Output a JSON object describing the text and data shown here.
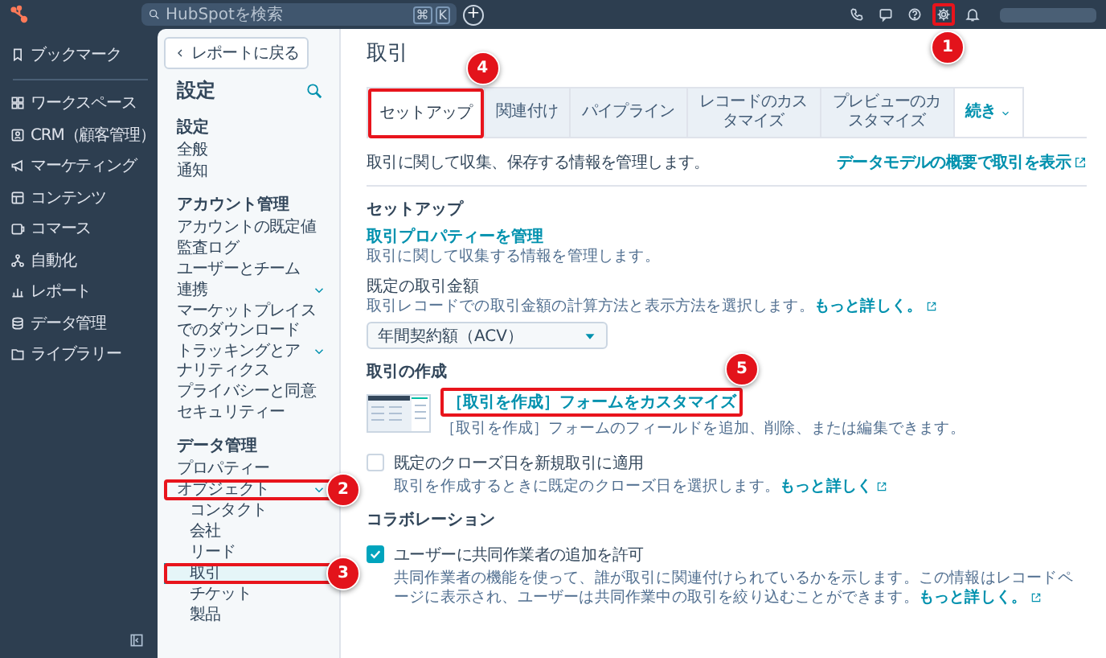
{
  "topbar": {
    "search": {
      "placeholder": "HubSpotを検索",
      "shortcut": [
        "⌘",
        "K"
      ]
    },
    "add_button": "+",
    "icons": [
      {
        "kind": "phone"
      },
      {
        "kind": "chat"
      },
      {
        "kind": "help"
      },
      {
        "kind": "settings",
        "callout": "1"
      },
      {
        "kind": "bell"
      }
    ]
  },
  "nav": {
    "items": [
      {
        "kind": "bookmark",
        "label": "ブックマーク"
      },
      {
        "kind": "workspace",
        "label": "ワークスペース"
      },
      {
        "kind": "crm",
        "label": "CRM（顧客管理）"
      },
      {
        "kind": "marketing",
        "label": "マーケティング"
      },
      {
        "kind": "content",
        "label": "コンテンツ"
      },
      {
        "kind": "commerce",
        "label": "コマース"
      },
      {
        "kind": "automation",
        "label": "自動化"
      },
      {
        "kind": "report",
        "label": "レポート"
      },
      {
        "kind": "data",
        "label": "データ管理"
      },
      {
        "kind": "library",
        "label": "ライブラリー"
      }
    ]
  },
  "settings_nav": {
    "back": "レポートに戻る",
    "title": "設定",
    "sections": [
      {
        "heading": "設定",
        "items": [
          {
            "label": "全般",
            "expandable": false,
            "selected": false
          },
          {
            "label": "通知",
            "expandable": false,
            "selected": false
          }
        ]
      },
      {
        "heading": "アカウント管理",
        "items": [
          {
            "label": "アカウントの既定値",
            "expandable": false,
            "selected": false
          },
          {
            "label": "監査ログ",
            "expandable": false,
            "selected": false
          },
          {
            "label": "ユーザーとチーム",
            "expandable": false,
            "selected": false
          },
          {
            "label": "連携",
            "expandable": true,
            "selected": false
          },
          {
            "label": "マーケットプレイスでのダウンロード",
            "expandable": false,
            "selected": false
          },
          {
            "label": "トラッキングとアナリティクス",
            "expandable": true,
            "selected": false
          },
          {
            "label": "プライバシーと同意",
            "expandable": false,
            "selected": false
          },
          {
            "label": "セキュリティー",
            "expandable": false,
            "selected": false
          }
        ]
      },
      {
        "heading": "データ管理",
        "items": [
          {
            "label": "プロパティー",
            "expandable": false,
            "selected": false
          },
          {
            "label": "オブジェクト",
            "expandable": true,
            "selected": false,
            "callout": "2",
            "children": [
              {
                "label": "コンタクト",
                "expandable": false,
                "selected": false
              },
              {
                "label": "会社",
                "expandable": false,
                "selected": false
              },
              {
                "label": "リード",
                "expandable": false,
                "selected": false
              },
              {
                "label": "取引",
                "expandable": false,
                "selected": true,
                "callout": "3"
              },
              {
                "label": "チケット",
                "expandable": false,
                "selected": false
              },
              {
                "label": "製品",
                "expandable": false,
                "selected": false
              }
            ]
          }
        ]
      }
    ]
  },
  "page": {
    "title": "取引",
    "view_link": "データモデルの概要で取引を表示",
    "tabs": [
      {
        "label": "セットアップ",
        "kind": "tab",
        "selected": true,
        "callout": "4"
      },
      {
        "label": "関連付け",
        "kind": "tab",
        "selected": false
      },
      {
        "label": "パイプライン",
        "kind": "tab",
        "selected": false
      },
      {
        "label": "レコードのカスタマイズ",
        "kind": "tab",
        "selected": false
      },
      {
        "label": "プレビューのカスタマイズ",
        "kind": "tab",
        "selected": false
      },
      {
        "label": "続き",
        "kind": "more",
        "selected": false
      }
    ],
    "description": "取引に関して収集、保存する情報を管理します。",
    "sections": [
      {
        "heading": "セットアップ",
        "items": [
          {
            "kind": "link",
            "link": "取引プロパティーを管理",
            "description": {
              "text": "取引に関して収集する情報を管理します。"
            }
          },
          {
            "kind": "select",
            "label": "既定の取引金額",
            "description": {
              "text": "取引レコードでの取引金額の計算方法と表示方法を選択します。",
              "link": "もっと詳しく。"
            },
            "value": "年間契約額（ACV）"
          }
        ]
      },
      {
        "heading": "取引の作成",
        "items": [
          {
            "kind": "preview_link",
            "link": "［取引を作成］フォームをカスタマイズ",
            "callout": "5",
            "description": {
              "text": "［取引を作成］フォームのフィールドを追加、削除、または編集できます。"
            }
          },
          {
            "kind": "checkbox",
            "label": "既定のクローズ日を新規取引に適用",
            "checked": false,
            "description": {
              "text": "取引を作成するときに既定のクローズ日を選択します。",
              "link": "もっと詳しく"
            }
          }
        ]
      },
      {
        "heading": "コラボレーション",
        "items": [
          {
            "kind": "checkbox",
            "label": "ユーザーに共同作業者の追加を許可",
            "checked": true,
            "description": {
              "text": "共同作業者の機能を使って、誰が取引に関連付けられているかを示します。この情報はレコードページに表示され、ユーザーは共同作業中の取引を絞り込むことができます。",
              "link": "もっと詳しく。"
            }
          }
        ]
      }
    ]
  }
}
